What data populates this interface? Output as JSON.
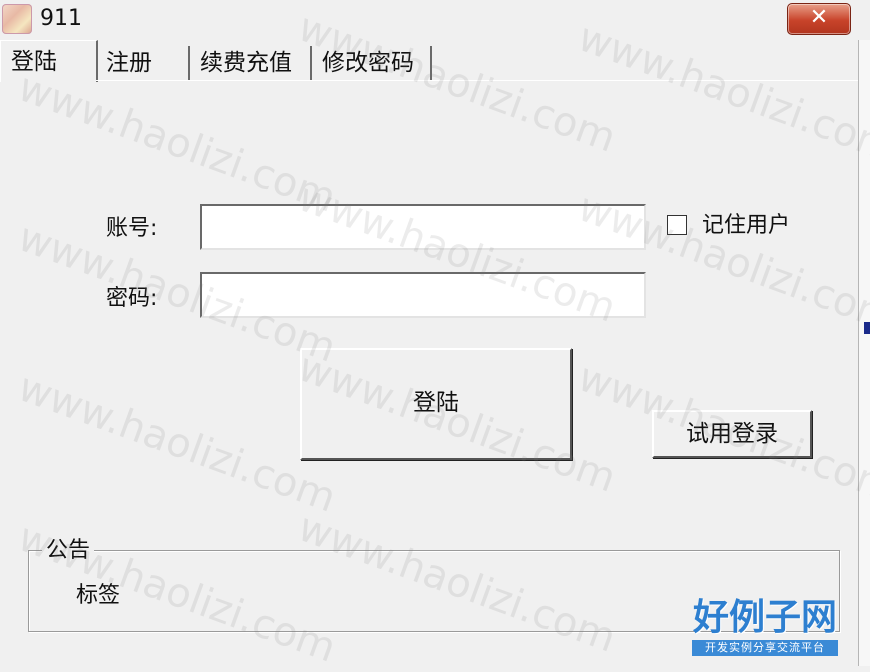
{
  "window": {
    "title": "911",
    "close_symbol": "✕"
  },
  "tabs": [
    {
      "label": "登陆",
      "active": true
    },
    {
      "label": "注册",
      "active": false
    },
    {
      "label": "续费充值",
      "active": false
    },
    {
      "label": "修改密码",
      "active": false
    }
  ],
  "login": {
    "account_label": "账号:",
    "account_value": "",
    "password_label": "密码:",
    "password_value": "",
    "remember_label": "记住用户",
    "remember_checked": false,
    "login_button": "登陆",
    "trial_button": "试用登录"
  },
  "notice": {
    "title": "公告",
    "text": "标签"
  },
  "watermark": {
    "text": "www.haolizi.com"
  },
  "logo": {
    "main": "好例子网",
    "sub": "开发实例分享交流平台"
  }
}
